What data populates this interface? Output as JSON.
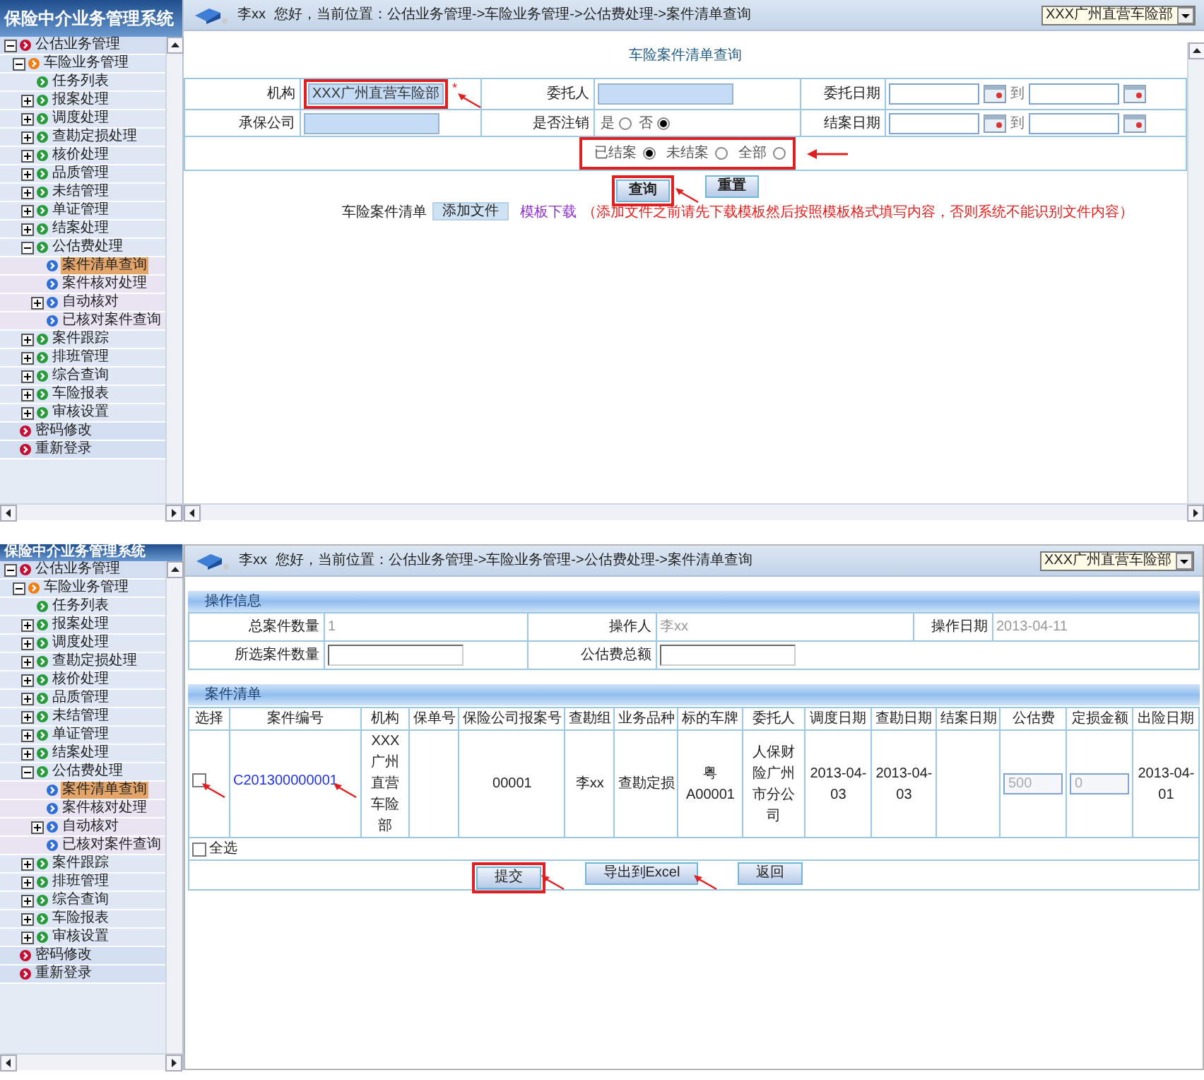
{
  "screens": [
    {
      "kind": "query",
      "sidebar": {
        "title": "保险中介业务管理系统",
        "items": [
          {
            "label": "公估业务管理",
            "expanded": true,
            "selected": false,
            "children": [
              {
                "label": "车险业务管理",
                "expanded": true,
                "selected": false,
                "children": [
                  {
                    "label": "任务列表",
                    "selected": false
                  },
                  {
                    "label": "报案处理",
                    "expanded": false,
                    "selected": false
                  },
                  {
                    "label": "调度处理",
                    "expanded": false,
                    "selected": false
                  },
                  {
                    "label": "查勘定损处理",
                    "expanded": false,
                    "selected": false
                  },
                  {
                    "label": "核价处理",
                    "expanded": false,
                    "selected": false
                  },
                  {
                    "label": "品质管理",
                    "expanded": false,
                    "selected": false
                  },
                  {
                    "label": "未结管理",
                    "expanded": false,
                    "selected": false
                  },
                  {
                    "label": "单证管理",
                    "expanded": false,
                    "selected": false
                  },
                  {
                    "label": "结案处理",
                    "expanded": false,
                    "selected": false
                  },
                  {
                    "label": "公估费处理",
                    "expanded": true,
                    "selected": false,
                    "children": [
                      {
                        "label": "案件清单查询",
                        "selected": true
                      },
                      {
                        "label": "案件核对处理",
                        "selected": false
                      },
                      {
                        "label": "自动核对",
                        "expanded": false,
                        "selected": false
                      },
                      {
                        "label": "已核对案件查询",
                        "selected": false
                      }
                    ]
                  },
                  {
                    "label": "案件跟踪",
                    "expanded": false,
                    "selected": false
                  },
                  {
                    "label": "排班管理",
                    "expanded": false,
                    "selected": false
                  },
                  {
                    "label": "综合查询",
                    "expanded": false,
                    "selected": false
                  },
                  {
                    "label": "车险报表",
                    "expanded": false,
                    "selected": false
                  },
                  {
                    "label": "审核设置",
                    "expanded": false,
                    "selected": false
                  }
                ]
              }
            ]
          },
          {
            "label": "密码修改",
            "selected": false
          },
          {
            "label": "重新登录",
            "selected": false
          }
        ]
      },
      "header": {
        "user": "李xx",
        "location": "您好，当前位置：公估业务管理->车险业务管理->公估费处理->案件清单查询",
        "org_select": "XXX广州直营车险部"
      },
      "form": {
        "title": "车险案件清单查询",
        "rows": [
          [
            {
              "label": "机构",
              "kind": "text",
              "value": "XXX广州直营车险部",
              "mark": "*",
              "boxed": true,
              "arrowed": true
            },
            {
              "label": "委托人",
              "kind": "text"
            },
            {
              "label": "委托日期",
              "kind": "date_range",
              "separator": "到"
            }
          ],
          [
            {
              "label": "承保公司",
              "kind": "text"
            },
            {
              "label": "是否注销",
              "kind": "radio",
              "options": [
                {
                  "label": "是",
                  "selected": false
                },
                {
                  "label": "否",
                  "selected": true
                }
              ]
            },
            {
              "label": "结案日期",
              "kind": "date_range",
              "separator": "到"
            }
          ]
        ],
        "status_filter": {
          "boxed": true,
          "arrowed": true,
          "options": [
            {
              "label": "已结案",
              "selected": true
            },
            {
              "label": "未结案",
              "selected": false
            },
            {
              "label": "全部",
              "selected": false
            }
          ]
        },
        "buttons": [
          {
            "label": "查询",
            "boxed": true,
            "arrowed": true
          },
          {
            "label": "重置",
            "boxed": false,
            "arrowed": false
          }
        ],
        "upload": {
          "label": "车险案件清单",
          "button": "添加文件",
          "link": "模板下载",
          "note": "（添加文件之前请先下载模板然后按照模板格式填写内容，否则系统不能识别文件内容）"
        }
      }
    },
    {
      "kind": "list",
      "sidebar": {
        "title": "保险中介业务管理系统",
        "items": [
          {
            "label": "公估业务管理",
            "expanded": true,
            "selected": false,
            "children": [
              {
                "label": "车险业务管理",
                "expanded": true,
                "selected": false,
                "children": [
                  {
                    "label": "任务列表",
                    "selected": false
                  },
                  {
                    "label": "报案处理",
                    "expanded": false,
                    "selected": false
                  },
                  {
                    "label": "调度处理",
                    "expanded": false,
                    "selected": false
                  },
                  {
                    "label": "查勘定损处理",
                    "expanded": false,
                    "selected": false
                  },
                  {
                    "label": "核价处理",
                    "expanded": false,
                    "selected": false
                  },
                  {
                    "label": "品质管理",
                    "expanded": false,
                    "selected": false
                  },
                  {
                    "label": "未结管理",
                    "expanded": false,
                    "selected": false
                  },
                  {
                    "label": "单证管理",
                    "expanded": false,
                    "selected": false
                  },
                  {
                    "label": "结案处理",
                    "expanded": false,
                    "selected": false
                  },
                  {
                    "label": "公估费处理",
                    "expanded": true,
                    "selected": false,
                    "children": [
                      {
                        "label": "案件清单查询",
                        "selected": true
                      },
                      {
                        "label": "案件核对处理",
                        "selected": false
                      },
                      {
                        "label": "自动核对",
                        "expanded": false,
                        "selected": false
                      },
                      {
                        "label": "已核对案件查询",
                        "selected": false
                      }
                    ]
                  },
                  {
                    "label": "案件跟踪",
                    "expanded": false,
                    "selected": false
                  },
                  {
                    "label": "排班管理",
                    "expanded": false,
                    "selected": false
                  },
                  {
                    "label": "综合查询",
                    "expanded": false,
                    "selected": false
                  },
                  {
                    "label": "车险报表",
                    "expanded": false,
                    "selected": false
                  },
                  {
                    "label": "审核设置",
                    "expanded": false,
                    "selected": false
                  }
                ]
              }
            ]
          },
          {
            "label": "密码修改",
            "selected": false
          },
          {
            "label": "重新登录",
            "selected": false
          }
        ]
      },
      "header": {
        "user": "李xx",
        "location": "您好，当前位置：公估业务管理->车险业务管理->公估费处理->案件清单查询",
        "org_select": "XXX广州直营车险部"
      },
      "info": {
        "title": "操作信息",
        "rows": [
          [
            {
              "label": "总案件数量",
              "kind": "text",
              "value": "1"
            },
            {
              "label": "操作人",
              "kind": "text",
              "value": "李xx"
            },
            {
              "label": "操作日期",
              "kind": "text",
              "value": "2013-04-11"
            }
          ],
          [
            {
              "label": "所选案件数量",
              "kind": "input"
            },
            {
              "label": "公估费总额",
              "kind": "input"
            }
          ]
        ]
      },
      "cases": {
        "title": "案件清单",
        "columns": [
          "选择",
          "案件编号",
          "机构",
          "保单号",
          "保险公司报案号",
          "查勘组",
          "业务品种",
          "标的车牌",
          "委托人",
          "调度日期",
          "查勘日期",
          "结案日期",
          "公估费",
          "定损金额",
          "出险日期"
        ],
        "rows": [
          [
            {
              "kind": "checkbox",
              "checked": false,
              "arrowed": true
            },
            {
              "kind": "link",
              "text": "C201300000001",
              "arrowed": true
            },
            {
              "kind": "text",
              "text": "XXX广州直营车险部"
            },
            {
              "kind": "empty"
            },
            {
              "kind": "text",
              "text": "00001"
            },
            {
              "kind": "text",
              "text": "李xx"
            },
            {
              "kind": "text",
              "text": "查勘定损"
            },
            {
              "kind": "text",
              "text": "粤A00001"
            },
            {
              "kind": "text",
              "text": "人保财险广州市分公司"
            },
            {
              "kind": "text",
              "text": "2013-04-03"
            },
            {
              "kind": "text",
              "text": "2013-04-03"
            },
            {
              "kind": "empty"
            },
            {
              "kind": "input",
              "value": "500",
              "disabled": true
            },
            {
              "kind": "input",
              "value": "0",
              "disabled": true
            },
            {
              "kind": "text",
              "text": "2013-04-01"
            }
          ]
        ],
        "select_all": {
          "label": "全选",
          "checked": false
        },
        "buttons": [
          {
            "label": "提交",
            "boxed": true,
            "arrowed": true
          },
          {
            "label": "导出到Excel",
            "boxed": false,
            "arrowed": true
          },
          {
            "label": "返回",
            "boxed": false,
            "arrowed": false
          }
        ]
      }
    }
  ]
}
